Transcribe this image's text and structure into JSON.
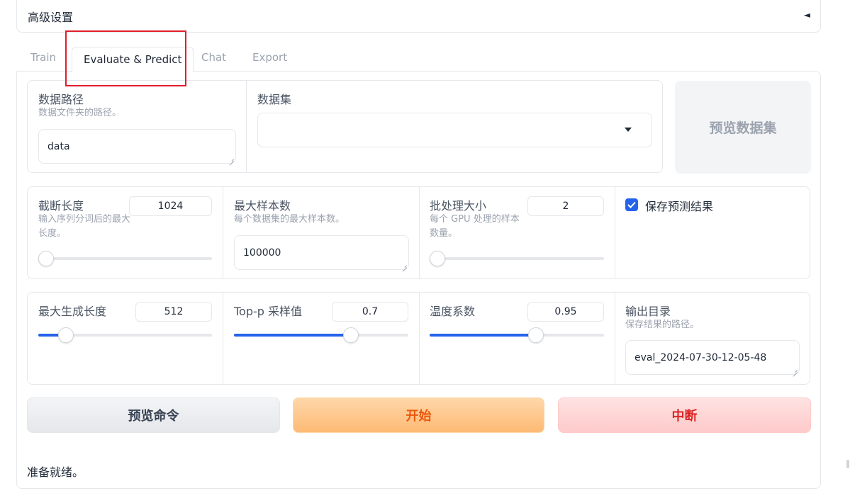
{
  "advanced": {
    "title": "高级设置",
    "arrow": "◄"
  },
  "tabs": [
    {
      "label": "Train",
      "active": false
    },
    {
      "label": "Evaluate & Predict",
      "active": true
    },
    {
      "label": "Chat",
      "active": false
    },
    {
      "label": "Export",
      "active": false
    }
  ],
  "row1": {
    "data_path": {
      "label": "数据路径",
      "info": "数据文件夹的路径。",
      "value": "data"
    },
    "dataset": {
      "label": "数据集",
      "value": ""
    },
    "preview_dataset_label": "预览数据集"
  },
  "row2": {
    "cutoff": {
      "label": "截断长度",
      "info": "输入序列分词后的最大长度。",
      "value": "1024",
      "fraction": 0.0
    },
    "max_samples": {
      "label": "最大样本数",
      "info": "每个数据集的最大样本数。",
      "value": "100000"
    },
    "batch_size": {
      "label": "批处理大小",
      "info": "每个 GPU 处理的样本数量。",
      "value": "2",
      "fraction": 0.0
    },
    "save_predictions": {
      "label": "保存预测结果",
      "checked": true
    }
  },
  "row3": {
    "max_new_tokens": {
      "label": "最大生成长度",
      "value": "512",
      "fraction": 0.16
    },
    "top_p": {
      "label": "Top-p 采样值",
      "value": "0.7",
      "fraction": 0.67
    },
    "temperature": {
      "label": "温度系数",
      "value": "0.95",
      "fraction": 0.61
    },
    "output_dir": {
      "label": "输出目录",
      "info": "保存结果的路径。",
      "value": "eval_2024-07-30-12-05-48"
    }
  },
  "buttons": {
    "preview_cmd": "预览命令",
    "start": "开始",
    "abort": "中断"
  },
  "status": "准备就绪。",
  "colors": {
    "accent": "#2563eb",
    "highlight": "#e11d2a",
    "start": "#ea580c",
    "abort": "#dc2626"
  }
}
